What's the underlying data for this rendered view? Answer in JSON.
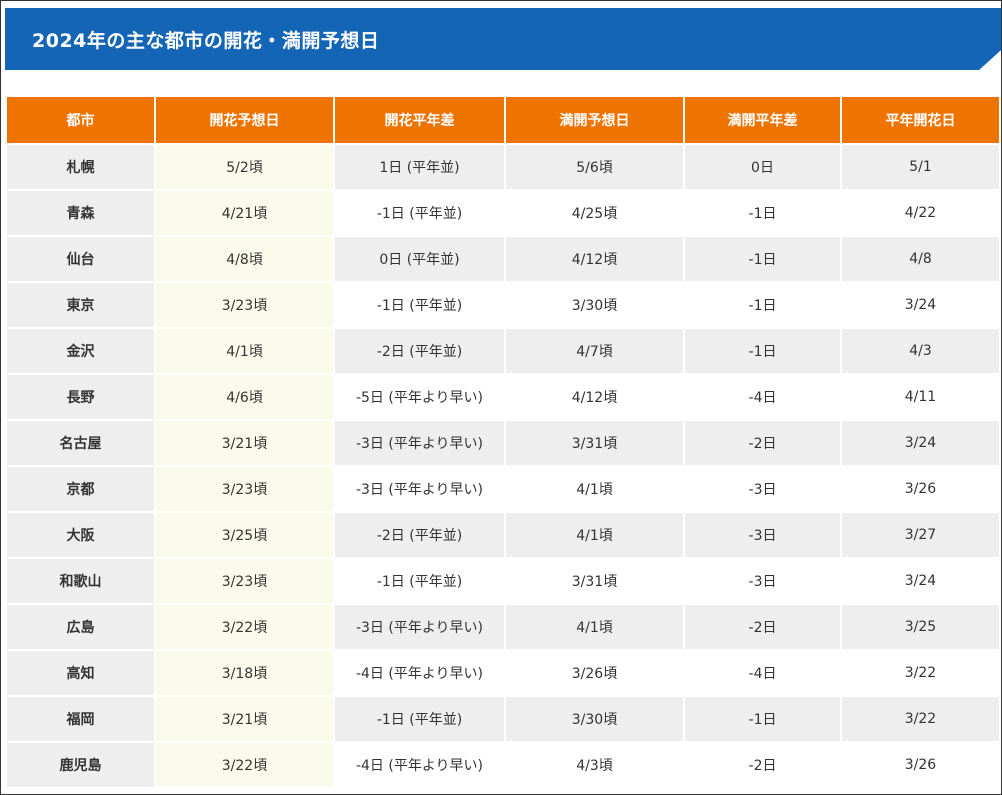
{
  "title": "2024年の主な都市の開花・満開予想日",
  "colors": {
    "title_bg": "#1565b6",
    "header_bg": "#ee7300",
    "bloom_col_bg": "#fbfbec",
    "row_bg": "#eeeeee"
  },
  "table": {
    "headers": [
      "都市",
      "開花予想日",
      "開花平年差",
      "満開予想日",
      "満開平年差",
      "平年開花日"
    ],
    "rows": [
      [
        "札幌",
        "5/2頃",
        "1日 (平年並)",
        "5/6頃",
        "0日",
        "5/1"
      ],
      [
        "青森",
        "4/21頃",
        "-1日 (平年並)",
        "4/25頃",
        "-1日",
        "4/22"
      ],
      [
        "仙台",
        "4/8頃",
        "0日 (平年並)",
        "4/12頃",
        "-1日",
        "4/8"
      ],
      [
        "東京",
        "3/23頃",
        "-1日 (平年並)",
        "3/30頃",
        "-1日",
        "3/24"
      ],
      [
        "金沢",
        "4/1頃",
        "-2日 (平年並)",
        "4/7頃",
        "-1日",
        "4/3"
      ],
      [
        "長野",
        "4/6頃",
        "-5日 (平年より早い)",
        "4/12頃",
        "-4日",
        "4/11"
      ],
      [
        "名古屋",
        "3/21頃",
        "-3日 (平年より早い)",
        "3/31頃",
        "-2日",
        "3/24"
      ],
      [
        "京都",
        "3/23頃",
        "-3日 (平年より早い)",
        "4/1頃",
        "-3日",
        "3/26"
      ],
      [
        "大阪",
        "3/25頃",
        "-2日 (平年並)",
        "4/1頃",
        "-3日",
        "3/27"
      ],
      [
        "和歌山",
        "3/23頃",
        "-1日 (平年並)",
        "3/31頃",
        "-3日",
        "3/24"
      ],
      [
        "広島",
        "3/22頃",
        "-3日 (平年より早い)",
        "4/1頃",
        "-2日",
        "3/25"
      ],
      [
        "高知",
        "3/18頃",
        "-4日 (平年より早い)",
        "3/26頃",
        "-4日",
        "3/22"
      ],
      [
        "福岡",
        "3/21頃",
        "-1日 (平年並)",
        "3/30頃",
        "-1日",
        "3/22"
      ],
      [
        "鹿児島",
        "3/22頃",
        "-4日 (平年より早い)",
        "4/3頃",
        "-2日",
        "3/26"
      ]
    ]
  }
}
